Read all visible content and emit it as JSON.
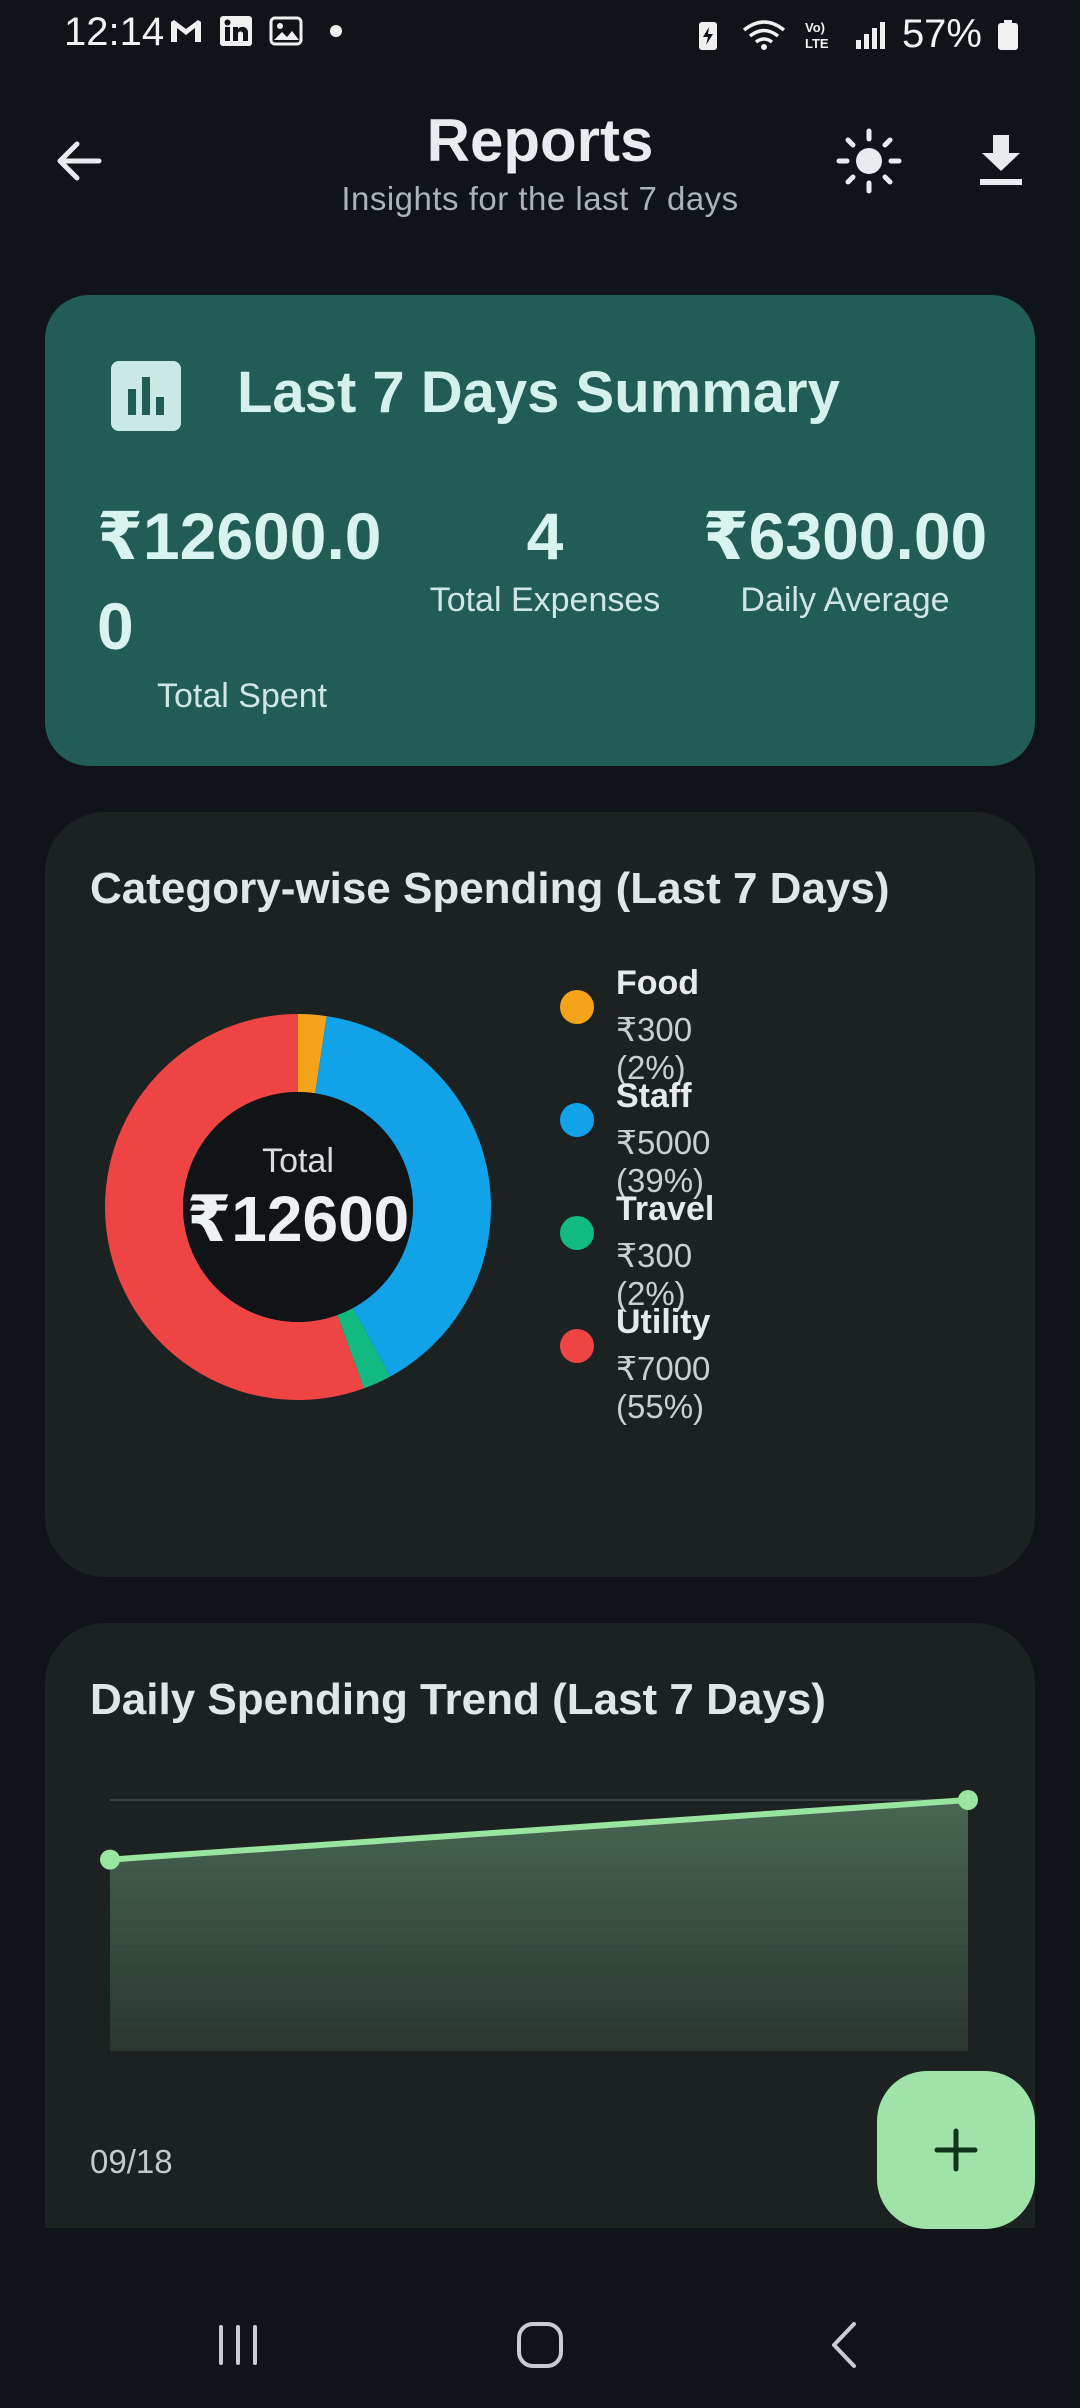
{
  "status_bar": {
    "time": "12:14",
    "battery": "57%",
    "icons_left": [
      "gmail-icon",
      "linkedin-icon",
      "gallery-icon"
    ],
    "icons_right": [
      "battery-saver-icon",
      "wifi-icon",
      "volte-icon",
      "signal-icon",
      "battery-icon"
    ]
  },
  "header": {
    "title": "Reports",
    "subtitle": "Insights for the last 7 days",
    "icons": [
      "back-arrow-icon",
      "sun-icon",
      "download-icon"
    ]
  },
  "summary": {
    "title": "Last 7 Days Summary",
    "total_spent": "₹12600.00",
    "total_spent_label": "Total Spent",
    "total_expenses": "4",
    "total_expenses_label": "Total Expenses",
    "daily_average": "₹6300.00",
    "daily_average_label": "Daily Average",
    "colors": {
      "card": "#215c55",
      "text": "#d4f1ec"
    }
  },
  "category_card": {
    "title": "Category-wise Spending (Last 7 Days)",
    "center_label": "Total",
    "center_value": "₹12600",
    "items": [
      {
        "name": "Food",
        "amount": "₹300 (2%)",
        "value": 300,
        "color": "#f5a31a"
      },
      {
        "name": "Staff",
        "amount": "₹5000 (39%)",
        "value": 5000,
        "color": "#11a2e8"
      },
      {
        "name": "Travel",
        "amount": "₹300 (2%)",
        "value": 300,
        "color": "#12b981"
      },
      {
        "name": "Utility",
        "amount": "₹7000 (55%)",
        "value": 7000,
        "color": "#ef4444"
      }
    ]
  },
  "trend_card": {
    "title": "Daily Spending Trend (Last 7 Days)",
    "x_tick": "09/18",
    "line_color": "#98e4a0"
  },
  "chart_data": [
    {
      "type": "pie",
      "categories": [
        "Food",
        "Staff",
        "Travel",
        "Utility"
      ],
      "values": [
        300,
        5000,
        300,
        7000
      ],
      "title": "Category-wise Spending (Last 7 Days)"
    },
    {
      "type": "area",
      "title": "Daily Spending Trend (Last 7 Days)",
      "x": [
        "09/18",
        ""
      ],
      "values": [
        5600,
        7000
      ],
      "ylim": [
        0,
        7000
      ],
      "grid": true
    }
  ],
  "fab": {
    "icon": "plus-icon"
  },
  "nav_bar": {
    "icons": [
      "recent-apps-icon",
      "home-icon",
      "back-icon"
    ]
  }
}
